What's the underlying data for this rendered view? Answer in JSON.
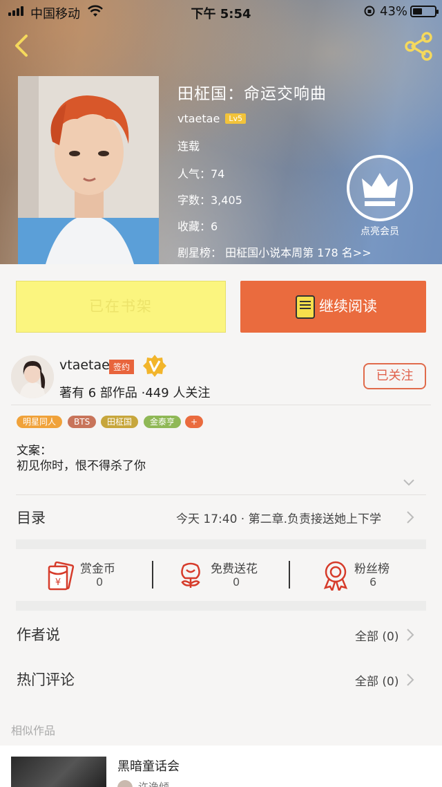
{
  "status_bar": {
    "carrier": "中国移动",
    "time": "下午 5:54",
    "battery": "43%",
    "battery_level": 0.43
  },
  "book": {
    "title": "田柾国：命运交响曲",
    "author": "vtaetae",
    "author_level": "Lv5",
    "status": "连载",
    "popularity": "人气：74",
    "word_count": "字数：3,405",
    "favorites": "收藏：6",
    "ranking": "剧星榜：  田柾国小说本周第 178 名>>",
    "membership_label": "点亮会员"
  },
  "actions": {
    "shelf_label": "已在书架",
    "read_label": "继续阅读"
  },
  "author_card": {
    "name": "vtaetae",
    "signed_badge": "签约",
    "works_line": "著有 6 部作品 ·449 人关注",
    "follow_label": "已关注"
  },
  "tags": [
    {
      "label": "明星同人",
      "color": "#f0a23a"
    },
    {
      "label": "BTS",
      "color": "#c8745a"
    },
    {
      "label": "田柾国",
      "color": "#c7a63c"
    },
    {
      "label": "金泰亨",
      "color": "#8fb856"
    },
    {
      "label": "+",
      "color": "#ea6b3e"
    }
  ],
  "synopsis": {
    "heading": "文案：",
    "text": "初见你时，恨不得杀了你"
  },
  "toc": {
    "label": "目录",
    "latest": "今天 17:40 · 第二章.负责接送她上下学"
  },
  "stats": [
    {
      "name": "赏金币",
      "value": "0",
      "icon": "red-envelope-icon"
    },
    {
      "name": "免费送花",
      "value": "0",
      "icon": "flower-icon"
    },
    {
      "name": "粉丝榜",
      "value": "6",
      "icon": "medal-icon"
    }
  ],
  "author_says": {
    "label": "作者说",
    "all": "全部 (0)"
  },
  "hot_comments": {
    "label": "热门评论",
    "all": "全部 (0)"
  },
  "similar": {
    "label": "相似作品",
    "title": "黑暗童话会",
    "author": "许逸倾"
  },
  "colors": {
    "accent": "#ea6b3e",
    "shelf_button": "#fbf57f",
    "level_badge": "#f2c33a"
  }
}
